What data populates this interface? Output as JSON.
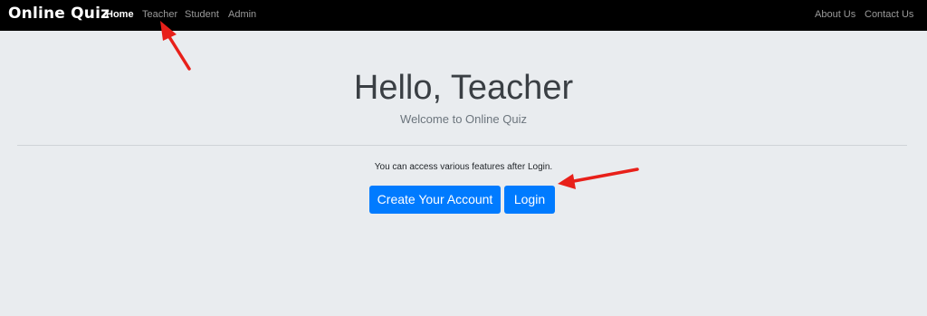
{
  "navbar": {
    "brand": "Online Quiz",
    "left_links": [
      "Home",
      "Teacher",
      "Student",
      "Admin"
    ],
    "right_links": [
      "About Us",
      "Contact Us"
    ],
    "active": "Home"
  },
  "jumbotron": {
    "title": "Hello, Teacher",
    "subtitle": "Welcome to Online Quiz",
    "info": "You can access various features after Login."
  },
  "buttons": {
    "create_account": "Create Your Account",
    "login": "Login"
  },
  "annotations": {
    "arrow_color": "#e8201a",
    "arrow_icon": "red-arrow-icon"
  },
  "colors": {
    "navbar_bg": "#000000",
    "page_bg": "#e9ecef",
    "primary": "#007bff"
  }
}
